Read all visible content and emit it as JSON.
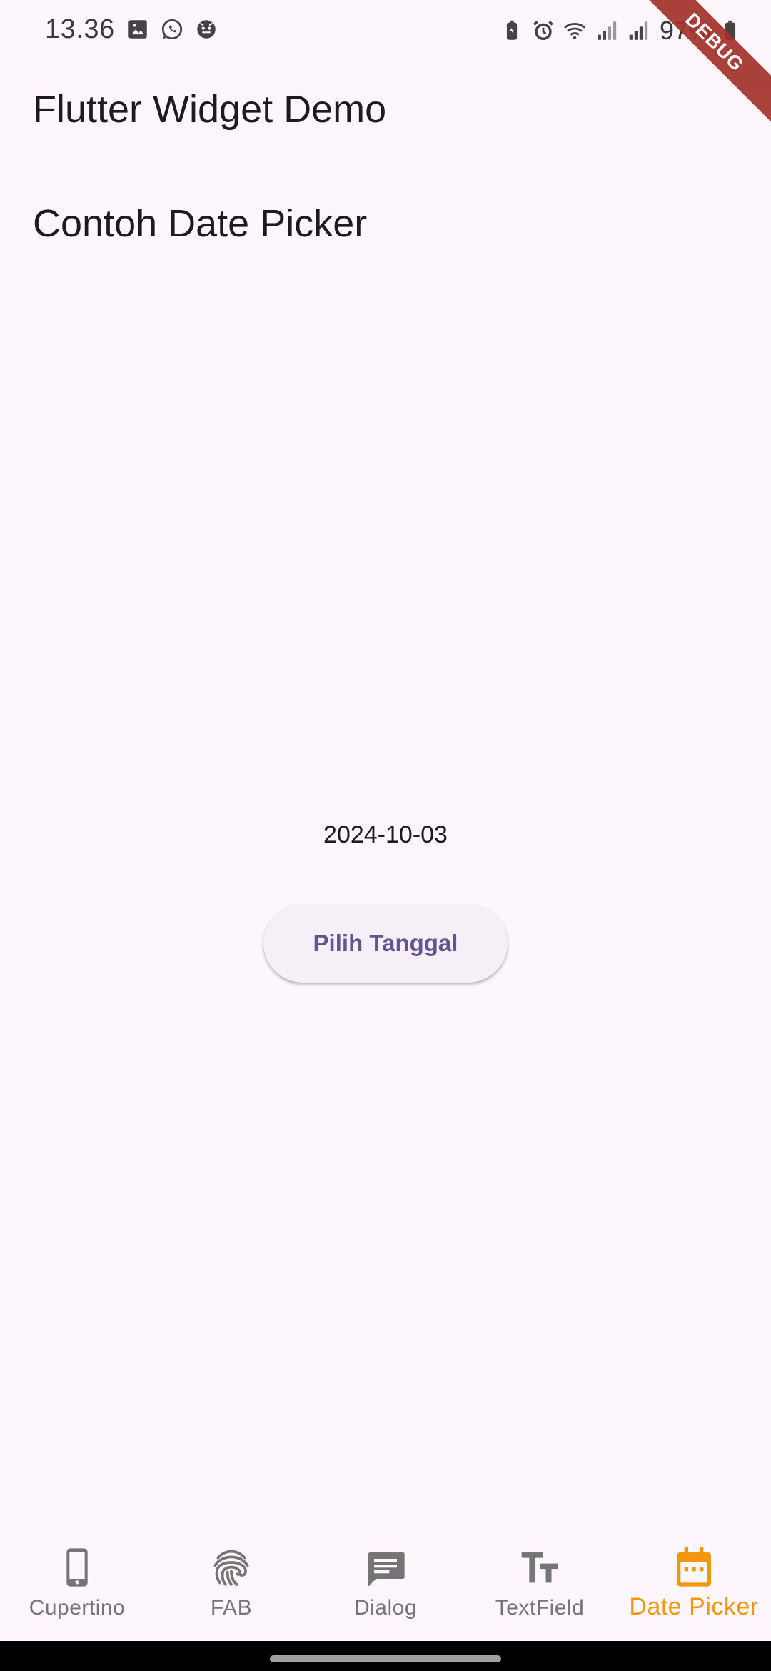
{
  "status_bar": {
    "time": "13.36",
    "battery_percent": "97%",
    "left_icons": [
      "gallery-icon",
      "whatsapp-icon",
      "app-icon"
    ],
    "right_icons": [
      "battery-saver-icon",
      "alarm-icon",
      "wifi-icon",
      "signal-icon",
      "signal-icon",
      "battery-icon"
    ]
  },
  "debug_banner": "DEBUG",
  "app": {
    "title": "Flutter Widget Demo",
    "heading": "Contoh Date Picker",
    "selected_date": "2024-10-03",
    "pick_button_label": "Pilih Tanggal"
  },
  "bottom_nav": {
    "active_index": 4,
    "active_color": "#f5960f",
    "inactive_color": "#757575",
    "items": [
      {
        "label": "Cupertino",
        "icon": "phone-icon"
      },
      {
        "label": "FAB",
        "icon": "fingerprint-icon"
      },
      {
        "label": "Dialog",
        "icon": "message-icon"
      },
      {
        "label": "TextField",
        "icon": "text-fields-icon"
      },
      {
        "label": "Date Picker",
        "icon": "calendar-icon"
      }
    ]
  },
  "colors": {
    "background": "#fdf7fd",
    "button_text": "#65558f",
    "button_bg": "#f5eff7",
    "debug_ribbon": "#a2322a"
  }
}
